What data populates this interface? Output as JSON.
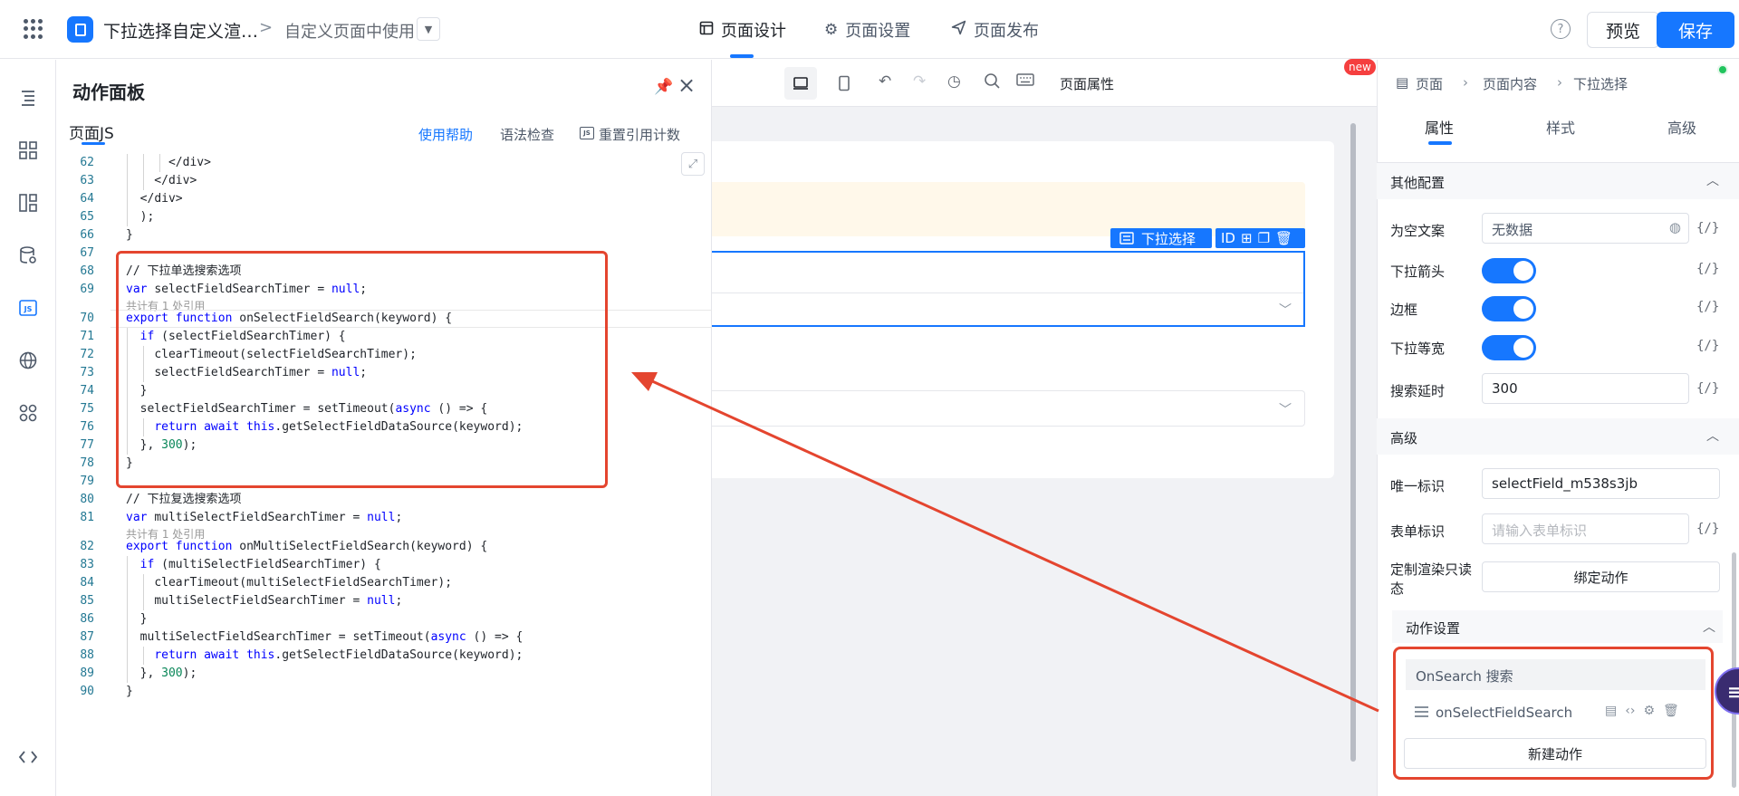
{
  "header": {
    "app_name": "下拉选择自定义渲…",
    "crumb_sep": ">",
    "page_name": "自定义页面中使用",
    "nav": [
      {
        "label": "页面设计",
        "icon": "layout-icon"
      },
      {
        "label": "页面设置",
        "icon": "gear-icon"
      },
      {
        "label": "页面发布",
        "icon": "send-icon"
      }
    ],
    "help": "?",
    "preview": "预览",
    "save": "保存"
  },
  "action_panel": {
    "title": "动作面板",
    "tab": "页面JS",
    "help_link": "使用帮助",
    "syntax_check": "语法检查",
    "js_badge": "JS",
    "recount": "重置引用计数"
  },
  "code_lines": [
    {
      "n": "62",
      "t": "      </div>",
      "indent": 3
    },
    {
      "n": "63",
      "t": "    </div>",
      "indent": 2
    },
    {
      "n": "64",
      "t": "  </div>",
      "indent": 1
    },
    {
      "n": "65",
      "t": "  );",
      "indent": 1
    },
    {
      "n": "66",
      "t": "}",
      "indent": 0
    },
    {
      "n": "67",
      "t": "",
      "indent": 0
    },
    {
      "n": "68",
      "t": "// 下拉单选搜索选项",
      "kind": "comment",
      "indent": 0
    },
    {
      "n": "69",
      "t": "var selectFieldSearchTimer = null;",
      "indent": 0
    },
    {
      "n": "70",
      "t": "export function onSelectFieldSearch(keyword) {",
      "indent": 0
    },
    {
      "n": "71",
      "t": "  if (selectFieldSearchTimer) {",
      "indent": 1
    },
    {
      "n": "72",
      "t": "    clearTimeout(selectFieldSearchTimer);",
      "indent": 2
    },
    {
      "n": "73",
      "t": "    selectFieldSearchTimer = null;",
      "indent": 2
    },
    {
      "n": "74",
      "t": "  }",
      "indent": 1
    },
    {
      "n": "75",
      "t": "  selectFieldSearchTimer = setTimeout(async () => {",
      "indent": 1
    },
    {
      "n": "76",
      "t": "    return await this.getSelectFieldDataSource(keyword);",
      "indent": 2
    },
    {
      "n": "77",
      "t": "  }, 300);",
      "indent": 1
    },
    {
      "n": "78",
      "t": "}",
      "indent": 0
    },
    {
      "n": "79",
      "t": "",
      "indent": 0
    },
    {
      "n": "80",
      "t": "// 下拉复选搜索选项",
      "kind": "comment",
      "indent": 0
    },
    {
      "n": "81",
      "t": "var multiSelectFieldSearchTimer = null;",
      "indent": 0
    },
    {
      "n": "82",
      "t": "export function onMultiSelectFieldSearch(keyword) {",
      "indent": 0
    },
    {
      "n": "83",
      "t": "  if (multiSelectFieldSearchTimer) {",
      "indent": 1
    },
    {
      "n": "84",
      "t": "    clearTimeout(multiSelectFieldSearchTimer);",
      "indent": 2
    },
    {
      "n": "85",
      "t": "    multiSelectFieldSearchTimer = null;",
      "indent": 2
    },
    {
      "n": "86",
      "t": "  }",
      "indent": 1
    },
    {
      "n": "87",
      "t": "  multiSelectFieldSearchTimer = setTimeout(async () => {",
      "indent": 1
    },
    {
      "n": "88",
      "t": "    return await this.getSelectFieldDataSource(keyword);",
      "indent": 2
    },
    {
      "n": "89",
      "t": "  }, 300);",
      "indent": 1
    },
    {
      "n": "90",
      "t": "}",
      "indent": 0
    }
  ],
  "ref_hint": "共计有 1 处引用",
  "canvas": {
    "page_props": "页面属性",
    "new_badge": "new",
    "component_badge": "下拉选择",
    "id_label": "ID"
  },
  "right_panel": {
    "breadcrumb": [
      "页面",
      "页面内容",
      "下拉选择"
    ],
    "tabs": [
      "属性",
      "样式",
      "高级"
    ],
    "section_other": "其他配置",
    "empty_text_label": "为空文案",
    "empty_text_value": "无数据",
    "arrow_label": "下拉箭头",
    "border_label": "边框",
    "equal_width_label": "下拉等宽",
    "search_delay_label": "搜索延时",
    "search_delay_value": "300",
    "var_btn": "{/}",
    "section_advanced": "高级",
    "unique_id_label": "唯一标识",
    "unique_id_value": "selectField_m538s3jb",
    "form_id_label": "表单标识",
    "form_id_placeholder": "请输入表单标识",
    "readonly_label_1": "定制渲染只读",
    "readonly_label_2": "态",
    "bind_action": "绑定动作",
    "action_settings": "动作设置",
    "event_name": "OnSearch 搜索",
    "handler_name": "onSelectFieldSearch",
    "new_action": "新建动作"
  },
  "colors": {
    "accent": "#1677ff",
    "annotation": "#e4452f"
  }
}
